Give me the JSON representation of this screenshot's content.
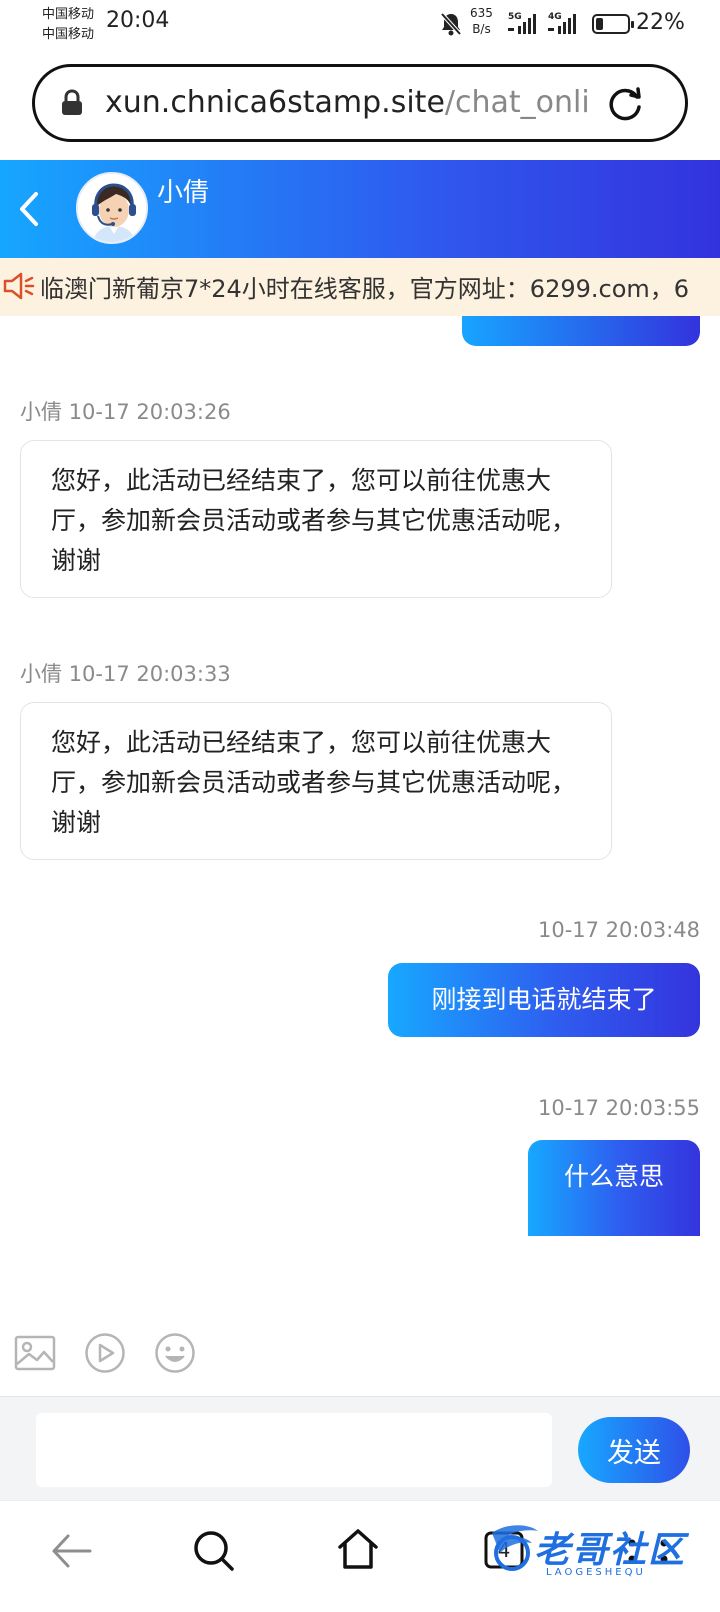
{
  "status_bar": {
    "carrier_1": "中国移动",
    "carrier_2": "中国移动",
    "time": "20:04",
    "net_speed_value": "635",
    "net_speed_unit": "B/s",
    "signal_1_label": "5G",
    "signal_2_label": "4G",
    "battery_percent": "22%",
    "battery_level": 0.22
  },
  "address_bar": {
    "url_host": "xun.chnica6stamp.site",
    "url_path": "/chat_onli"
  },
  "chat_header": {
    "agent_name": "小倩"
  },
  "notice": {
    "text": "临澳门新葡京7*24小时在线客服，官方网址：6299.com，6"
  },
  "messages": [
    {
      "direction": "in",
      "sender": "小倩",
      "timestamp": "10-17 20:03:26",
      "text": "您好，此活动已经结束了，您可以前往优惠大厅，参加新会员活动或者参与其它优惠活动呢，谢谢"
    },
    {
      "direction": "in",
      "sender": "小倩",
      "timestamp": "10-17 20:03:33",
      "text": "您好，此活动已经结束了，您可以前往优惠大厅，参加新会员活动或者参与其它优惠活动呢，谢谢"
    },
    {
      "direction": "out",
      "timestamp": "10-17 20:03:48",
      "text": "刚接到电话就结束了"
    },
    {
      "direction": "out",
      "timestamp": "10-17 20:03:55",
      "text": "什么意思"
    }
  ],
  "composer": {
    "input_value": "",
    "send_label": "发送"
  },
  "bottom_nav": {
    "tabs_count": "4"
  },
  "watermark": {
    "text": "老哥社区",
    "subtext": "LAOGESHEQU"
  },
  "colors": {
    "header_gradient_start": "#16a6ff",
    "header_gradient_end": "#3333dd",
    "notice_bg": "#fdf2e0",
    "notice_icon": "#d9502a"
  }
}
